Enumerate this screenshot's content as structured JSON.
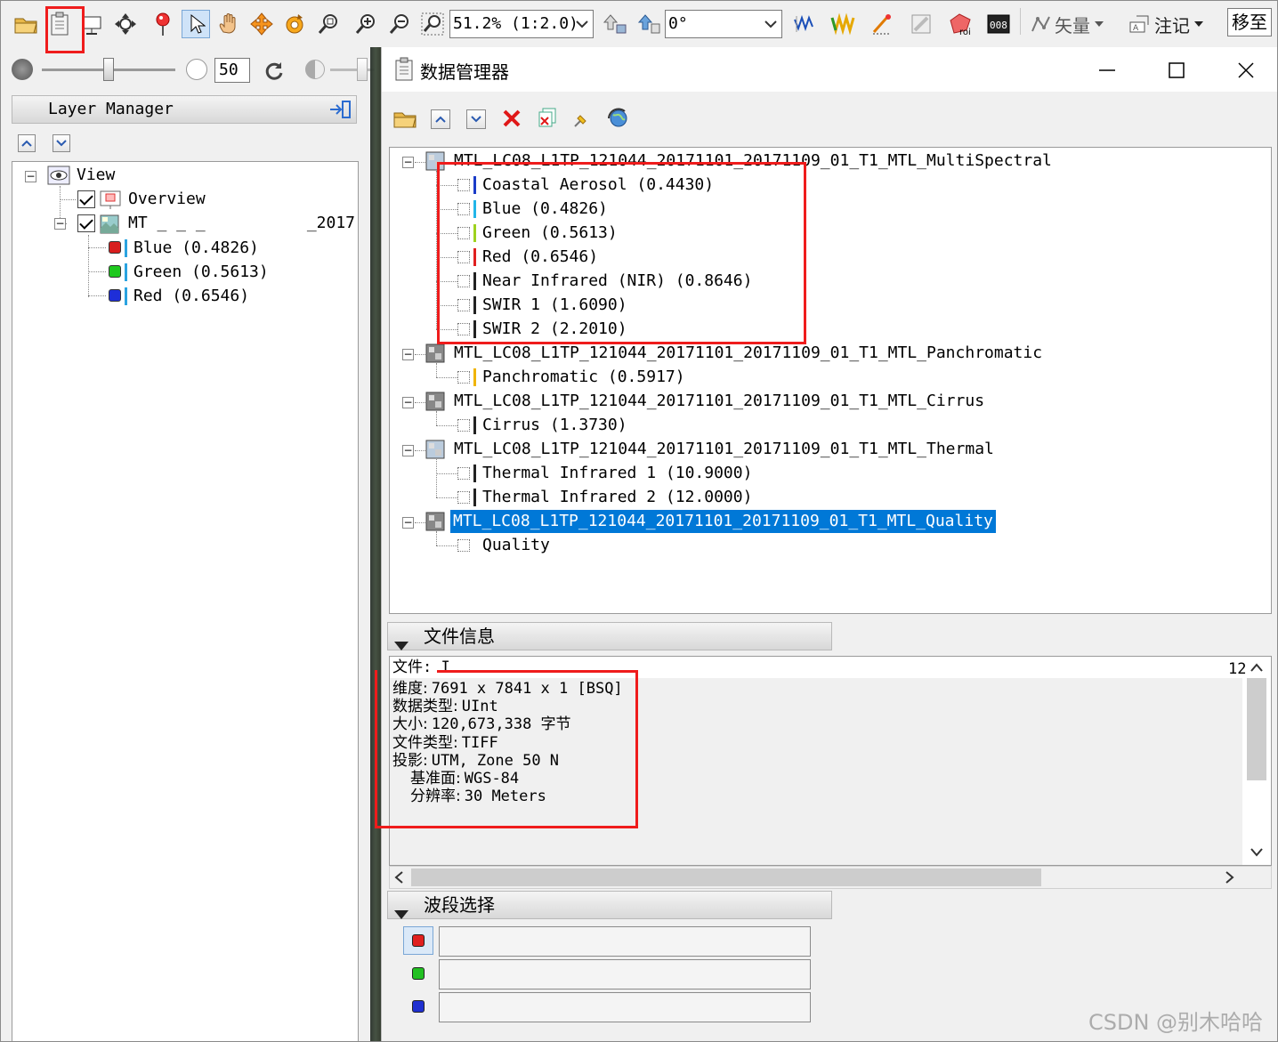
{
  "toolbar": {
    "zoom_value": "51.2% (1:2.0)",
    "rotation_value": "0°",
    "vector_menu_label": "矢量",
    "annotation_menu_label": "注记",
    "goto_button_label": "移至",
    "transparency_value": "50"
  },
  "layer_manager": {
    "title": "Layer Manager",
    "root_label": "View",
    "overview_label": "Overview",
    "layer_prefix": "MT _    _    _",
    "layer_suffix": "_2017",
    "bands": [
      {
        "label": "Blue (0.4826)",
        "color": "#d81e1e"
      },
      {
        "label": "Green (0.5613)",
        "color": "#1ec81e"
      },
      {
        "label": "Red (0.6546)",
        "color": "#1e2ed8"
      }
    ]
  },
  "data_manager": {
    "title": "数据管理器",
    "files": [
      {
        "name": "MTL_LC08_L1TP_121044_20171101_20171109_01_T1_MTL_MultiSpectral",
        "selected": false,
        "bands": [
          {
            "label": "Coastal Aerosol (0.4430)",
            "color": "#1b3cc8"
          },
          {
            "label": "Blue (0.4826)",
            "color": "#22b5e8"
          },
          {
            "label": "Green (0.5613)",
            "color": "#9ed21e"
          },
          {
            "label": "Red (0.6546)",
            "color": "#e02020"
          },
          {
            "label": "Near Infrared (NIR) (0.8646)",
            "color": "#222222"
          },
          {
            "label": "SWIR 1 (1.6090)",
            "color": "#222222"
          },
          {
            "label": "SWIR 2 (2.2010)",
            "color": "#222222"
          }
        ]
      },
      {
        "name": "MTL_LC08_L1TP_121044_20171101_20171109_01_T1_MTL_Panchromatic",
        "selected": false,
        "bands": [
          {
            "label": "Panchromatic (0.5917)",
            "color": "#f0b400"
          }
        ]
      },
      {
        "name": "MTL_LC08_L1TP_121044_20171101_20171109_01_T1_MTL_Cirrus",
        "selected": false,
        "bands": [
          {
            "label": "Cirrus (1.3730)",
            "color": "#222222"
          }
        ]
      },
      {
        "name": "MTL_LC08_L1TP_121044_20171101_20171109_01_T1_MTL_Thermal",
        "selected": false,
        "bands": [
          {
            "label": "Thermal Infrared 1 (10.9000)",
            "color": "#222222"
          },
          {
            "label": "Thermal Infrared 2 (12.0000)",
            "color": "#222222"
          }
        ]
      },
      {
        "name": "MTL_LC08_L1TP_121044_20171101_20171109_01_T1_MTL_Quality",
        "selected": true,
        "bands": [
          {
            "label": "Quality",
            "color": ""
          }
        ]
      }
    ],
    "file_info": {
      "header": "文件信息",
      "file_line": "文件: I",
      "right_marker": "12",
      "lines": [
        {
          "label": "维度:",
          "value": "7691 x 7841 x 1 [BSQ]"
        },
        {
          "label": "数据类型:",
          "value": "UInt"
        },
        {
          "label": "大小:",
          "value": "120,673,338 字节"
        },
        {
          "label": "文件类型:",
          "value": "TIFF"
        },
        {
          "label": "投影:",
          "value": "UTM, Zone 50 N"
        },
        {
          "label": "基准面:",
          "value": "WGS-84"
        },
        {
          "label": "分辨率:",
          "value": "30 Meters"
        }
      ]
    },
    "band_select": {
      "header": "波段选择",
      "slots": [
        {
          "color": "#e02020",
          "value": ""
        },
        {
          "color": "#22c022",
          "value": ""
        },
        {
          "color": "#2030d0",
          "value": ""
        }
      ]
    }
  },
  "watermark": "CSDN @别木哈哈"
}
